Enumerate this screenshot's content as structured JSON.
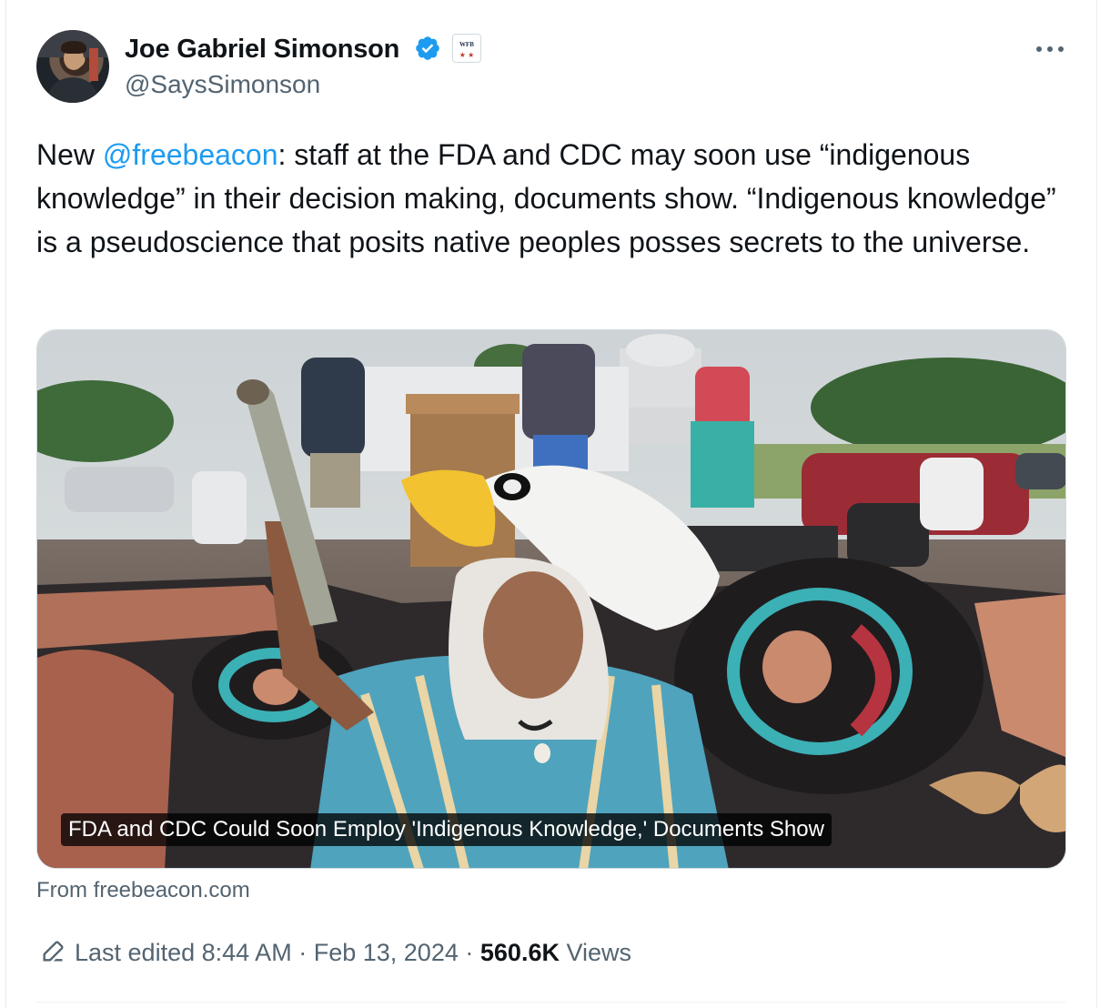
{
  "author": {
    "display_name": "Joe Gabriel Simonson",
    "handle": "@SaysSimonson",
    "verified": true,
    "affiliation_badge_text": "WFB"
  },
  "tweet": {
    "text_before": "New ",
    "mention": "@freebeacon",
    "text_after": ": staff at the FDA and CDC may soon use “indigenous knowledge” in their decision making, documents show. “Indigenous knowledge” is a pseudoscience that posits native peoples posses secrets to the universe."
  },
  "card": {
    "caption": "FDA and CDC Could Soon Employ 'Indigenous Knowledge,' Documents Show",
    "source": "From freebeacon.com"
  },
  "meta": {
    "edited_label": "Last edited",
    "time": "8:44 AM",
    "separator": "·",
    "date": "Feb 13, 2024",
    "views_count": "560.6K",
    "views_label": "Views"
  },
  "icons": {
    "verified": "verified-badge-icon",
    "more": "more-icon",
    "edit": "pencil-icon"
  },
  "colors": {
    "link": "#1d9bf0",
    "verified": "#1d9bf0",
    "secondary_text": "#536471",
    "primary_text": "#0f1419"
  }
}
